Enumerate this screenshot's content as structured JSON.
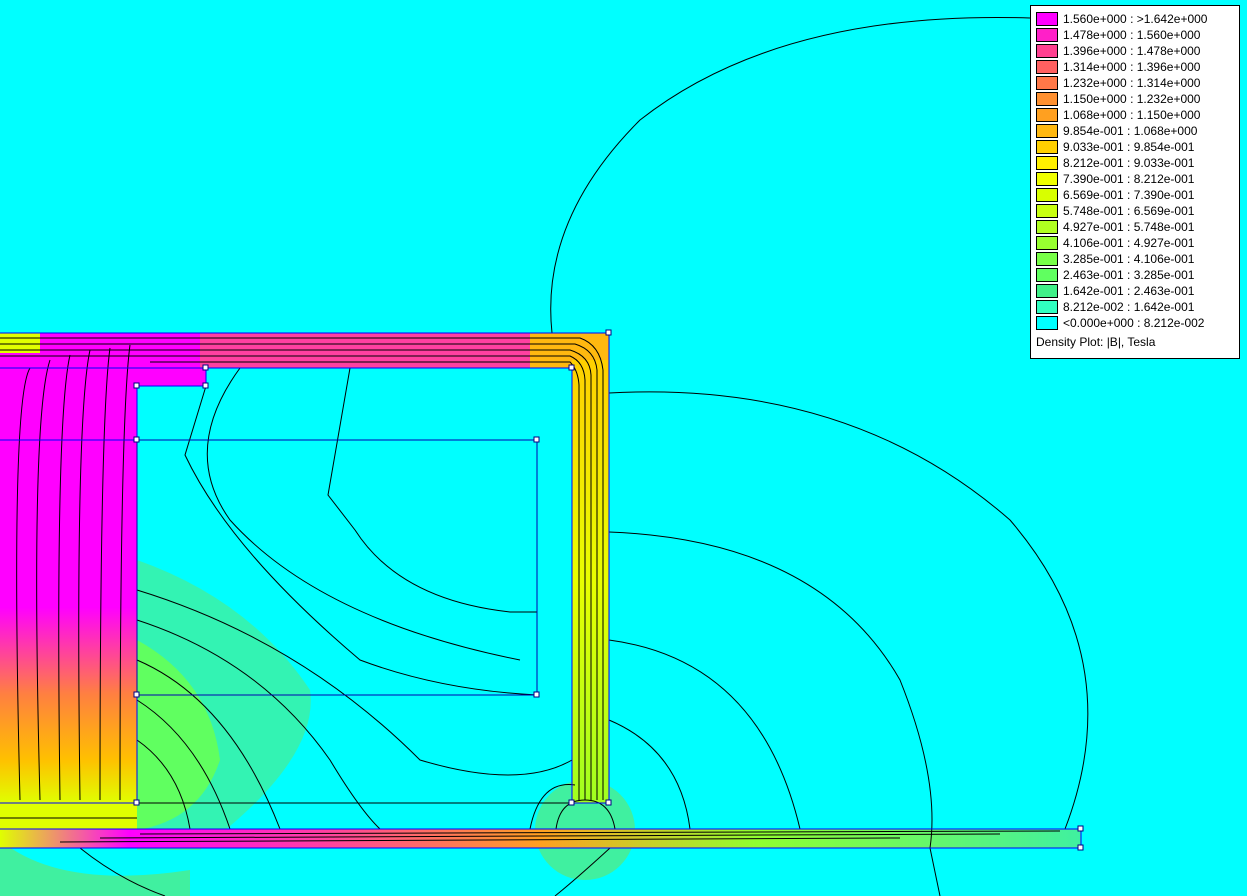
{
  "legend": {
    "caption": "Density Plot: |B|, Tesla",
    "items": [
      {
        "label": "1.560e+000 : >1.642e+000",
        "color": "#ff00ff"
      },
      {
        "label": "1.478e+000 : 1.560e+000",
        "color": "#ff20c8"
      },
      {
        "label": "1.396e+000 : 1.478e+000",
        "color": "#ff4090"
      },
      {
        "label": "1.314e+000 : 1.396e+000",
        "color": "#ff6060"
      },
      {
        "label": "1.232e+000 : 1.314e+000",
        "color": "#ff7848"
      },
      {
        "label": "1.150e+000 : 1.232e+000",
        "color": "#ff9030"
      },
      {
        "label": "1.068e+000 : 1.150e+000",
        "color": "#ffa020"
      },
      {
        "label": "9.854e-001 : 1.068e+000",
        "color": "#ffb810"
      },
      {
        "label": "9.033e-001 : 9.854e-001",
        "color": "#ffd000"
      },
      {
        "label": "8.212e-001 : 9.033e-001",
        "color": "#fff000"
      },
      {
        "label": "7.390e-001 : 8.212e-001",
        "color": "#f0ff00"
      },
      {
        "label": "6.569e-001 : 7.390e-001",
        "color": "#d8ff00"
      },
      {
        "label": "5.748e-001 : 6.569e-001",
        "color": "#c8ff10"
      },
      {
        "label": "4.927e-001 : 5.748e-001",
        "color": "#b0ff20"
      },
      {
        "label": "4.106e-001 : 4.927e-001",
        "color": "#98ff30"
      },
      {
        "label": "3.285e-001 : 4.106e-001",
        "color": "#78ff48"
      },
      {
        "label": "2.463e-001 : 3.285e-001",
        "color": "#60ff60"
      },
      {
        "label": "1.642e-001 : 2.463e-001",
        "color": "#40f088"
      },
      {
        "label": "8.212e-002 : 1.642e-001",
        "color": "#30ffc0"
      },
      {
        "label": "<0.000e+000 : 8.212e-002",
        "color": "#00ffff"
      }
    ]
  }
}
